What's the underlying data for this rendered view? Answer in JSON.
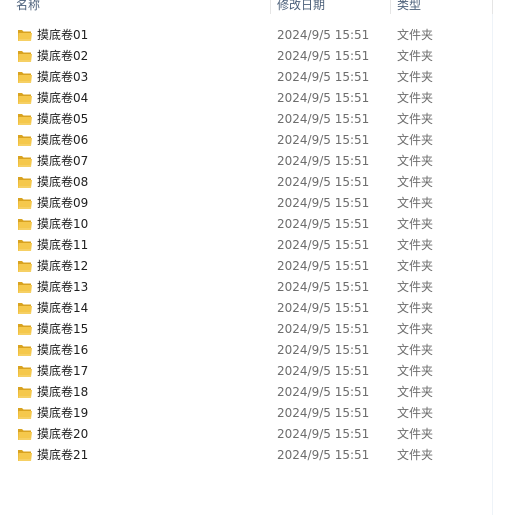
{
  "columns": {
    "name": "名称",
    "date": "修改日期",
    "type": "类型"
  },
  "icons": {
    "folder": "folder-icon"
  },
  "colors": {
    "folder_front": "#f5c84c",
    "folder_back": "#d9a320",
    "header_text": "#4c607a",
    "meta_text": "#6d6d6d"
  },
  "rows": [
    {
      "name": "摸底卷01",
      "date": "2024/9/5 15:51",
      "type": "文件夹"
    },
    {
      "name": "摸底卷02",
      "date": "2024/9/5 15:51",
      "type": "文件夹"
    },
    {
      "name": "摸底卷03",
      "date": "2024/9/5 15:51",
      "type": "文件夹"
    },
    {
      "name": "摸底卷04",
      "date": "2024/9/5 15:51",
      "type": "文件夹"
    },
    {
      "name": "摸底卷05",
      "date": "2024/9/5 15:51",
      "type": "文件夹"
    },
    {
      "name": "摸底卷06",
      "date": "2024/9/5 15:51",
      "type": "文件夹"
    },
    {
      "name": "摸底卷07",
      "date": "2024/9/5 15:51",
      "type": "文件夹"
    },
    {
      "name": "摸底卷08",
      "date": "2024/9/5 15:51",
      "type": "文件夹"
    },
    {
      "name": "摸底卷09",
      "date": "2024/9/5 15:51",
      "type": "文件夹"
    },
    {
      "name": "摸底卷10",
      "date": "2024/9/5 15:51",
      "type": "文件夹"
    },
    {
      "name": "摸底卷11",
      "date": "2024/9/5 15:51",
      "type": "文件夹"
    },
    {
      "name": "摸底卷12",
      "date": "2024/9/5 15:51",
      "type": "文件夹"
    },
    {
      "name": "摸底卷13",
      "date": "2024/9/5 15:51",
      "type": "文件夹"
    },
    {
      "name": "摸底卷14",
      "date": "2024/9/5 15:51",
      "type": "文件夹"
    },
    {
      "name": "摸底卷15",
      "date": "2024/9/5 15:51",
      "type": "文件夹"
    },
    {
      "name": "摸底卷16",
      "date": "2024/9/5 15:51",
      "type": "文件夹"
    },
    {
      "name": "摸底卷17",
      "date": "2024/9/5 15:51",
      "type": "文件夹"
    },
    {
      "name": "摸底卷18",
      "date": "2024/9/5 15:51",
      "type": "文件夹"
    },
    {
      "name": "摸底卷19",
      "date": "2024/9/5 15:51",
      "type": "文件夹"
    },
    {
      "name": "摸底卷20",
      "date": "2024/9/5 15:51",
      "type": "文件夹"
    },
    {
      "name": "摸底卷21",
      "date": "2024/9/5 15:51",
      "type": "文件夹"
    }
  ]
}
